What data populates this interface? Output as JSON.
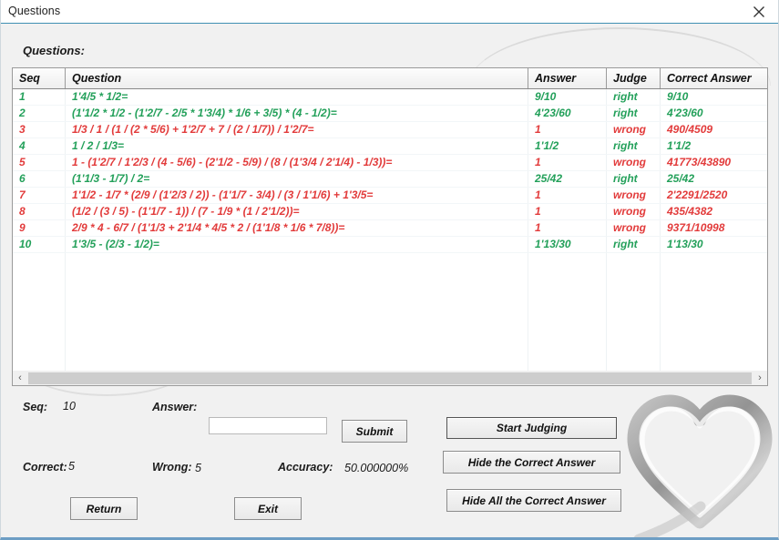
{
  "window": {
    "title": "Questions",
    "close_icon": "close-icon"
  },
  "section": {
    "heading": "Questions:"
  },
  "table": {
    "columns": [
      "Seq",
      "Question",
      "Answer",
      "Judge",
      "Correct Answer"
    ],
    "rows": [
      {
        "seq": "1",
        "question": "1'4/5 * 1/2=",
        "answer": "9/10",
        "judge": "right",
        "correct": "9/10",
        "status": "right"
      },
      {
        "seq": "2",
        "question": "(1'1/2 * 1/2 - (1'2/7 - 2/5 * 1'3/4) * 1/6 + 3/5) * (4 - 1/2)=",
        "answer": "4'23/60",
        "judge": "right",
        "correct": "4'23/60",
        "status": "right"
      },
      {
        "seq": "3",
        "question": "1/3 / 1 / (1 / (2 * 5/6) + 1'2/7 + 7 / (2 / 1/7)) / 1'2/7=",
        "answer": "1",
        "judge": "wrong",
        "correct": "490/4509",
        "status": "wrong"
      },
      {
        "seq": "4",
        "question": "1 / 2 / 1/3=",
        "answer": "1'1/2",
        "judge": "right",
        "correct": "1'1/2",
        "status": "right"
      },
      {
        "seq": "5",
        "question": "1 - (1'2/7 / 1'2/3 / (4 - 5/6) - (2'1/2 - 5/9) / (8 / (1'3/4 / 2'1/4) - 1/3))=",
        "answer": "1",
        "judge": "wrong",
        "correct": "41773/43890",
        "status": "wrong"
      },
      {
        "seq": "6",
        "question": "(1'1/3 - 1/7) / 2=",
        "answer": "25/42",
        "judge": "right",
        "correct": "25/42",
        "status": "right"
      },
      {
        "seq": "7",
        "question": "1'1/2 - 1/7 * (2/9 / (1'2/3 / 2)) - (1'1/7 - 3/4) / (3 / 1'1/6) + 1'3/5=",
        "answer": "1",
        "judge": "wrong",
        "correct": "2'2291/2520",
        "status": "wrong"
      },
      {
        "seq": "8",
        "question": "(1/2 / (3 / 5) - (1'1/7 - 1)) / (7 - 1/9 * (1 / 2'1/2))=",
        "answer": "1",
        "judge": "wrong",
        "correct": "435/4382",
        "status": "wrong"
      },
      {
        "seq": "9",
        "question": "2/9 * 4 - 6/7 / (1'1/3 + 2'1/4 * 4/5 * 2 / (1'1/8 * 1/6 * 7/8))=",
        "answer": "1",
        "judge": "wrong",
        "correct": "9371/10998",
        "status": "wrong"
      },
      {
        "seq": "10",
        "question": "1'3/5 - (2/3 - 1/2)=",
        "answer": "1'13/30",
        "judge": "right",
        "correct": "1'13/30",
        "status": "right"
      }
    ]
  },
  "scrollbar": {
    "left_arrow": "‹",
    "right_arrow": "›"
  },
  "status": {
    "seq_label": "Seq:",
    "seq_value": "10",
    "answer_label": "Answer:",
    "answer_value": "",
    "answer_placeholder": "",
    "correct_label": "Correct:",
    "correct_value": "5",
    "wrong_label": "Wrong:",
    "wrong_value": "5",
    "accuracy_label": "Accuracy:",
    "accuracy_value": "50.000000%"
  },
  "buttons": {
    "submit": "Submit",
    "return": "Return",
    "exit": "Exit",
    "start_judging": "Start Judging",
    "hide_correct_answer": "Hide the Correct Answer",
    "hide_all_correct_answer": "Hide All the Correct Answer"
  },
  "colors": {
    "right": "#23a05a",
    "wrong": "#e23b3b",
    "accent": "#3f8fb3",
    "window_bg": "#f1f1f1"
  }
}
